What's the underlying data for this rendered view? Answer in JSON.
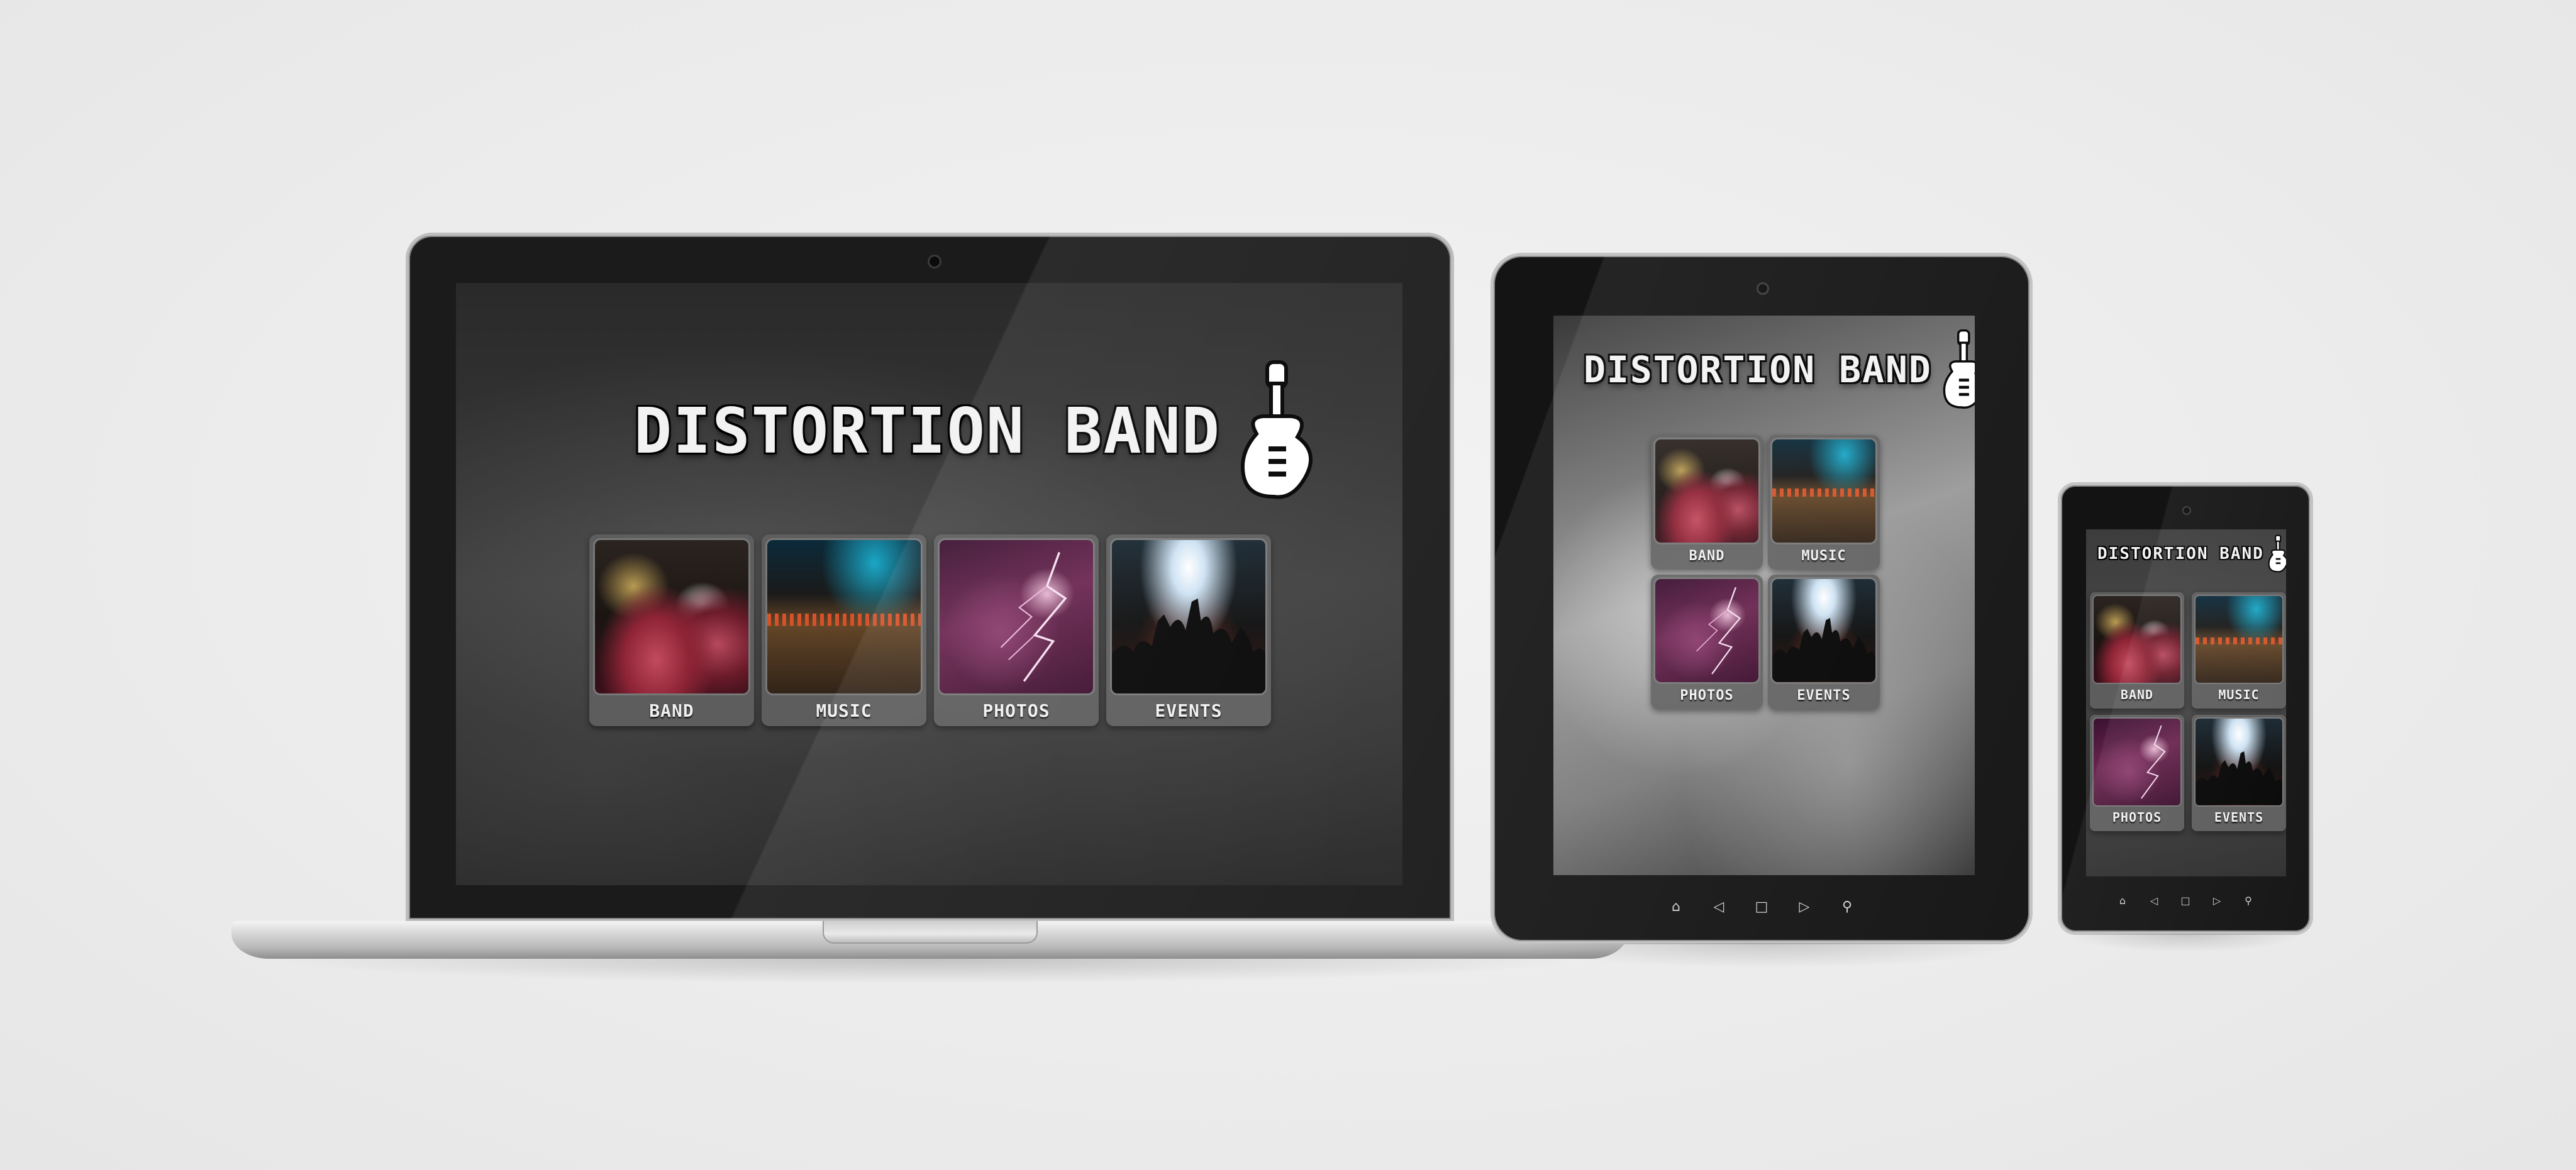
{
  "site": {
    "title": "DISTORTION BAND",
    "logo_icon": "guitar-icon",
    "tiles": [
      {
        "label": "BAND",
        "image": "drum-kit-photo"
      },
      {
        "label": "MUSIC",
        "image": "mixing-console-photo"
      },
      {
        "label": "PHOTOS",
        "image": "lightning-sky-photo"
      },
      {
        "label": "EVENTS",
        "image": "concert-crowd-photo"
      }
    ]
  },
  "devices": {
    "tablet_nav": [
      "home-icon",
      "back-icon",
      "recents-icon",
      "forward-icon",
      "search-icon"
    ],
    "phone_nav": [
      "home-icon",
      "back-icon",
      "recents-icon",
      "forward-icon",
      "search-icon"
    ]
  },
  "colors": {
    "page_background": "#ececec",
    "device_bezel": "#1b1b1b",
    "tile_background": "#5f5f5f",
    "title_text": "#f2f2f2"
  }
}
